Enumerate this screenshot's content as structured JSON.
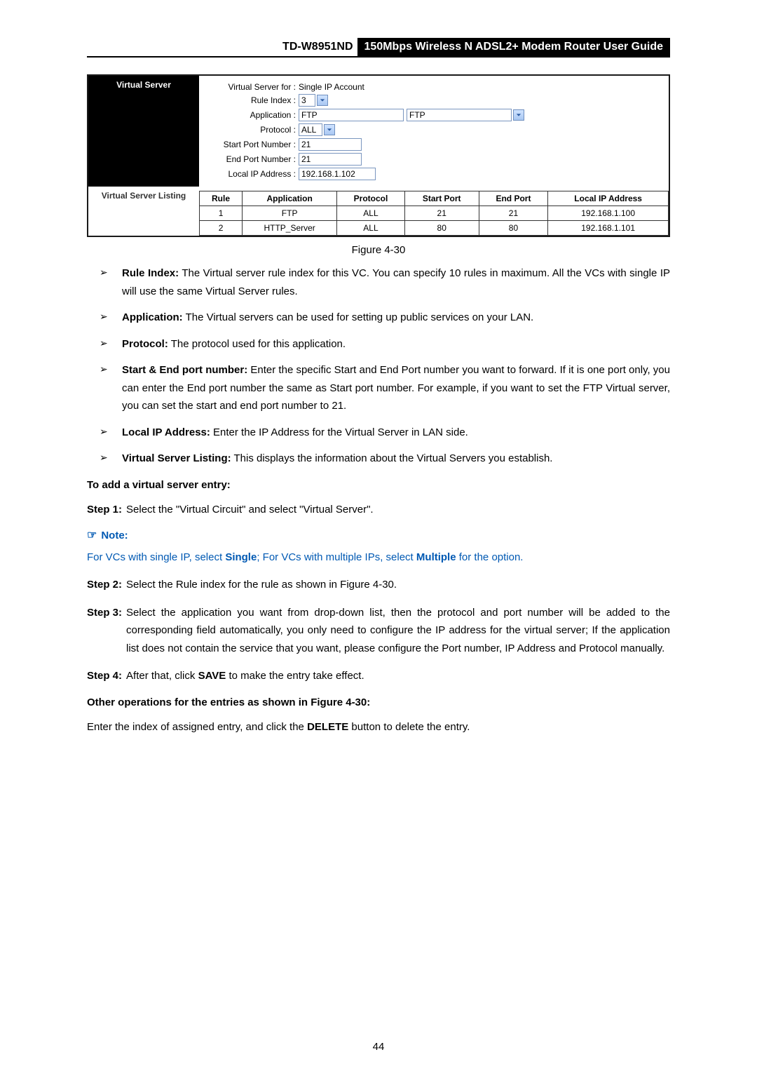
{
  "header": {
    "model": "TD-W8951ND",
    "title": "150Mbps Wireless N ADSL2+ Modem Router User Guide"
  },
  "panel": {
    "sidebar_virtual_server": "Virtual Server",
    "sidebar_listing": "Virtual Server Listing",
    "vs_for_label": "Virtual Server for :",
    "vs_for_value": "Single IP Account",
    "rule_index_label": "Rule Index :",
    "rule_index_value": "3",
    "application_label": "Application :",
    "application_text": "FTP",
    "application_select": "FTP",
    "protocol_label": "Protocol :",
    "protocol_value": "ALL",
    "start_port_label": "Start Port Number :",
    "start_port_value": "21",
    "end_port_label": "End Port Number :",
    "end_port_value": "21",
    "local_ip_label": "Local IP Address :",
    "local_ip_value": "192.168.1.102",
    "table": {
      "cols": [
        "Rule",
        "Application",
        "Protocol",
        "Start Port",
        "End Port",
        "Local IP Address"
      ],
      "rows": [
        {
          "rule": "1",
          "app": "FTP",
          "proto": "ALL",
          "start": "21",
          "end": "21",
          "ip": "192.168.1.100"
        },
        {
          "rule": "2",
          "app": "HTTP_Server",
          "proto": "ALL",
          "start": "80",
          "end": "80",
          "ip": "192.168.1.101"
        }
      ]
    }
  },
  "figure_caption": "Figure 4-30",
  "bullets": {
    "rule_index_title": "Rule Index:",
    "rule_index_text": " The Virtual server rule index for this VC. You can specify 10 rules in maximum. All the VCs with single IP will use the same Virtual Server rules.",
    "application_title": "Application:",
    "application_text": " The Virtual servers can be used for setting up public services on your LAN.",
    "protocol_title": "Protocol:",
    "protocol_text": " The protocol used for this application.",
    "port_title": "Start & End port number:",
    "port_text": " Enter the specific Start and End Port number you want to forward. If it is one port only, you can enter the End port number the same as Start port number. For example, if you want to set the FTP Virtual server, you can set the start and end port number to 21.",
    "localip_title": "Local IP Address:",
    "localip_text": " Enter the IP Address for the Virtual Server in LAN side.",
    "listing_title": "Virtual Server Listing:",
    "listing_text": " This displays the information about the Virtual Servers you establish."
  },
  "add_heading": "To add a virtual server entry:",
  "step1_label": "Step 1:",
  "step1_text": "Select the \"Virtual Circuit\" and select \"Virtual Server\".",
  "note_label": "Note:",
  "note_part1": "For VCs with single IP, select ",
  "note_bold1": "Single",
  "note_part2": "; For VCs with multiple IPs, select ",
  "note_bold2": "Multiple",
  "note_part3": " for the option.",
  "step2_label": "Step 2:",
  "step2_text": "Select the Rule index for the rule as shown in Figure 4-30.",
  "step3_label": "Step 3:",
  "step3_text": "Select the application you want from drop-down list, then the protocol and port number will be added to the corresponding field automatically, you only need to configure the IP address for the virtual server; If the application list does not contain the service that you want, please configure the Port number, IP Address and Protocol manually.",
  "step4_label": "Step 4:",
  "step4_pre": "After that, click ",
  "step4_bold": "SAVE",
  "step4_post": " to make the entry take effect.",
  "other_heading": "Other operations for the entries as shown in Figure 4-30:",
  "other_pre": "Enter the index of assigned entry, and click the ",
  "other_bold": "DELETE",
  "other_post": " button to delete the entry.",
  "page_number": "44"
}
